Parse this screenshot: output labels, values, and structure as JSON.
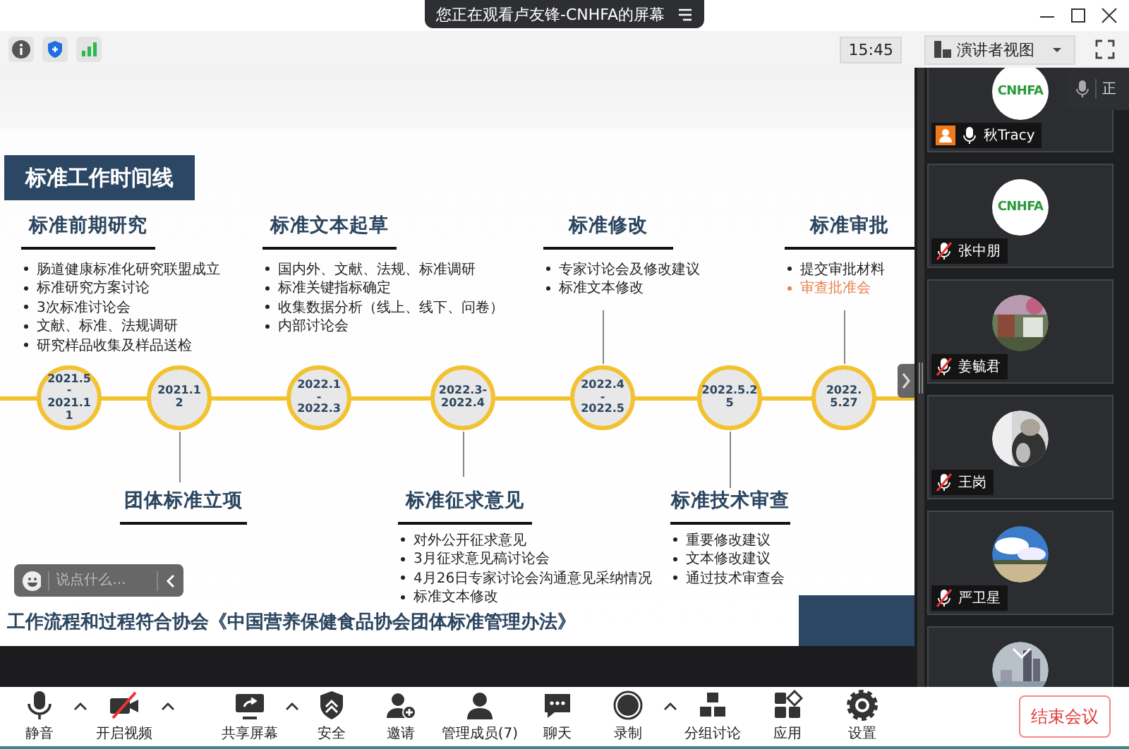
{
  "window": {
    "banner": "您正在观看卢友锋-CNHFA的屏幕"
  },
  "info_bar": {
    "time": "15:45",
    "view_button": "演讲者视图"
  },
  "slide": {
    "title": "标准工作时间线",
    "stages": [
      {
        "kind": "top",
        "heading": "标准前期研究",
        "bullets": [
          {
            "text": "肠道健康标准化研究联盟成立",
            "highlight": false
          },
          {
            "text": "标准研究方案讨论",
            "highlight": false
          },
          {
            "text": "3次标准讨论会",
            "highlight": false
          },
          {
            "text": "文献、标准、法规调研",
            "highlight": false
          },
          {
            "text": "研究样品收集及样品送检",
            "highlight": false
          }
        ]
      },
      {
        "kind": "bottom",
        "heading": "团体标准立项",
        "connector": true
      },
      {
        "kind": "top",
        "heading": "标准文本起草",
        "bullets": [
          {
            "text": "国内外、文献、法规、标准调研",
            "highlight": false
          },
          {
            "text": "标准关键指标确定",
            "highlight": false
          },
          {
            "text": "收集数据分析（线上、线下、问卷）",
            "highlight": false
          },
          {
            "text": "内部讨论会",
            "highlight": false
          }
        ]
      },
      {
        "kind": "bottom",
        "heading": "标准征求意见",
        "connector": true,
        "bullets": [
          {
            "text": "对外公开征求意见",
            "highlight": false
          },
          {
            "text": "3月征求意见稿讨论会",
            "highlight": false
          },
          {
            "text": "4月26日专家讨论会沟通意见采纳情况",
            "highlight": false
          },
          {
            "text": "标准文本修改",
            "highlight": false
          }
        ]
      },
      {
        "kind": "top",
        "heading": "标准修改",
        "connector": true,
        "bullets": [
          {
            "text": "专家讨论会及修改建议",
            "highlight": false
          },
          {
            "text": "标准文本修改",
            "highlight": false
          }
        ]
      },
      {
        "kind": "bottom",
        "heading": "标准技术审查",
        "connector": true,
        "bullets": [
          {
            "text": "重要修改建议",
            "highlight": false
          },
          {
            "text": "文本修改建议",
            "highlight": false
          },
          {
            "text": "通过技术审查会",
            "highlight": false
          }
        ]
      },
      {
        "kind": "top",
        "heading": "标准审批",
        "connector": true,
        "bullets": [
          {
            "text": "提交审批材料",
            "highlight": false
          },
          {
            "text": "审查批准会",
            "highlight": true
          }
        ]
      }
    ],
    "dates": [
      "2021.5\n-\n2021.1\n1",
      "2021.1\n2",
      "2022.1\n-\n2022.3",
      "2022.3-\n2022.4",
      "2022.4\n-\n2022.5",
      "2022.5.2\n5",
      "2022. 5.27"
    ],
    "footer": "工作流程和过程符合协会《中国营养保健食品协会团体标准管理办法》"
  },
  "chat_box": {
    "placeholder": "说点什么..."
  },
  "audio_pill": {
    "label": "正"
  },
  "participants": [
    {
      "name": "秋Tracy",
      "host": true,
      "muted": false,
      "kind": "logo",
      "logo_text": "CNHFA"
    },
    {
      "name": "张中朋",
      "host": false,
      "muted": true,
      "kind": "logo",
      "logo_text": "CNHFA"
    },
    {
      "name": "姜毓君",
      "host": false,
      "muted": true,
      "kind": "picture"
    },
    {
      "name": "王岗",
      "host": false,
      "muted": true,
      "kind": "picture"
    },
    {
      "name": "严卫星",
      "host": false,
      "muted": true,
      "kind": "picture"
    },
    {
      "kind": "picture"
    }
  ],
  "toolbar": [
    {
      "label": "静音",
      "has_menu": true
    },
    {
      "label": "开启视频",
      "has_menu": true
    },
    {
      "label": "共享屏幕",
      "has_menu": true
    },
    {
      "label": "安全",
      "has_menu": false
    },
    {
      "label": "邀请",
      "has_menu": false
    },
    {
      "label": "管理成员(7)",
      "has_menu": false
    },
    {
      "label": "聊天",
      "has_menu": false
    },
    {
      "label": "录制",
      "has_menu": true
    },
    {
      "label": "分组讨论",
      "has_menu": false
    },
    {
      "label": "应用",
      "has_menu": false
    },
    {
      "label": "设置",
      "has_menu": false
    }
  ],
  "end_button": "结束会议"
}
